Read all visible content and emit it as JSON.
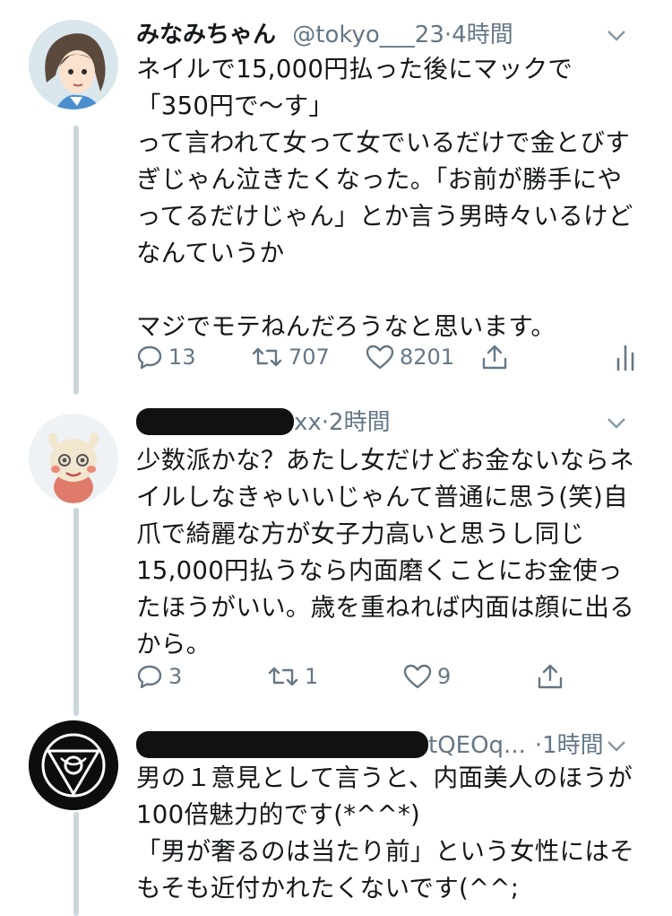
{
  "tweets": [
    {
      "name": "みなみちゃん",
      "handle": "@tokyo___23",
      "sep": "·",
      "time": "4時間",
      "lines": [
        "ネイルで15,000円払った後にマックで",
        "「350円で〜す」",
        "って言われて女って女でいるだけで金とびす",
        "ぎじゃん泣きたくなった。「お前が勝手にや",
        "ってるだけじゃん」とか言う男時々いるけど",
        "なんていうか",
        "",
        "マジでモテねんだろうなと思います。"
      ],
      "reply_count": "13",
      "retweet_count": "707",
      "like_count": "8201"
    },
    {
      "handle_suffix": "xx",
      "sep": "·",
      "time": "2時間",
      "lines": [
        "少数派かな？あたし女だけどお金ないならネ",
        "イルしなきゃいいじゃんて普通に思う(笑)自",
        "爪で綺麗な方が女子力高いと思うし同じ",
        "15,000円払うなら内面磨くことにお金使っ",
        "たほうがいい。歳を重ねれば内面は顔に出る",
        "から。"
      ],
      "reply_count": "3",
      "retweet_count": "1",
      "like_count": "9"
    },
    {
      "handle_suffix": "tQEOq...",
      "sep": "·",
      "time": "1時間",
      "lines": [
        "男の１意見として言うと、内面美人のほうが",
        "100倍魅力的です(*^^*)",
        "「男が奢るのは当たり前」という女性にはそ",
        "もそも近付かれたくないです(^^;"
      ]
    }
  ],
  "icons": [
    "reply-icon",
    "retweet-icon",
    "like-icon",
    "share-icon",
    "analytics-icon",
    "chevron-down-icon"
  ],
  "colors": {
    "text": "#14171a",
    "secondary": "#657786",
    "thread_line": "#ccd6dd"
  }
}
